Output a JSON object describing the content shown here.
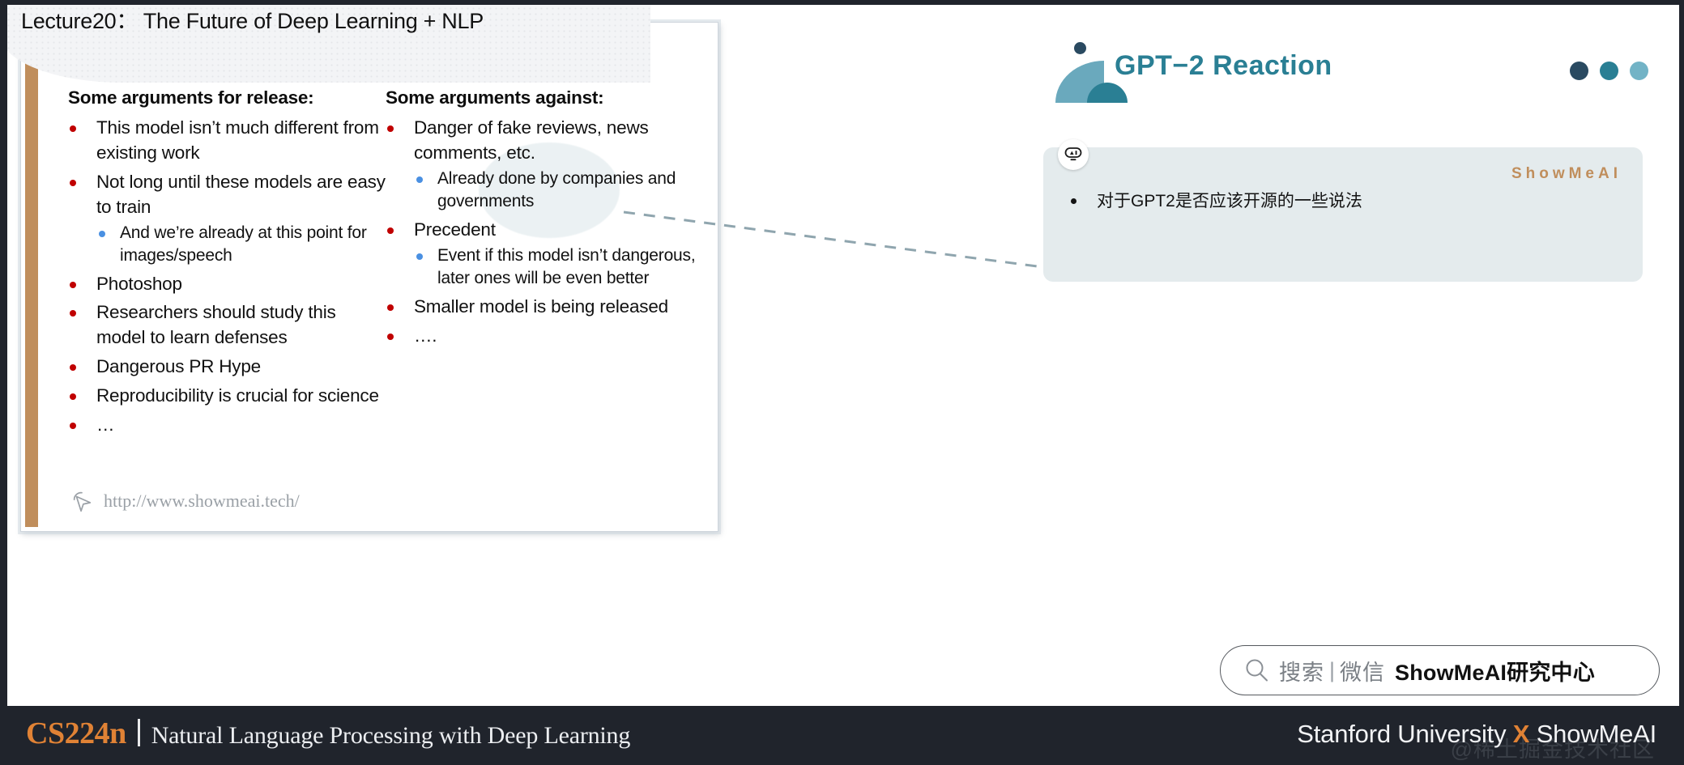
{
  "slide": {
    "title": "GPT-2 Reaction",
    "left_column": {
      "heading": "Some arguments for release:",
      "bullets": [
        {
          "text": "This model isn’t much different from existing work",
          "sub": []
        },
        {
          "text": "Not long until these models are easy to train",
          "sub": [
            "And we’re already at this point for images/speech"
          ]
        },
        {
          "text": "Photoshop",
          "sub": []
        },
        {
          "text": "Researchers should study this model to learn defenses",
          "sub": []
        },
        {
          "text": "Dangerous PR Hype",
          "sub": []
        },
        {
          "text": "Reproducibility is crucial for science",
          "sub": []
        },
        {
          "text": "…",
          "sub": []
        }
      ]
    },
    "right_column": {
      "heading": "Some arguments against:",
      "bullets": [
        {
          "text": "Danger of fake reviews, news comments, etc.",
          "sub": [
            "Already done by companies and governments"
          ]
        },
        {
          "text": "Precedent",
          "sub": [
            "Event if this model isn’t dangerous, later ones will be even better"
          ]
        },
        {
          "text": "Smaller model is being released",
          "sub": []
        },
        {
          "text": "….",
          "sub": []
        }
      ]
    },
    "url": "http://www.showmeai.tech/",
    "url_icon": "cursor-pointer-icon",
    "accent_bar_color": "#c08e5c",
    "title_color": "#2d7fe0",
    "bullet_color_level1": "#c00000",
    "bullet_color_level2": "#4a90e2"
  },
  "right_panel": {
    "lecture_banner": "Lecture20： The Future of Deep Learning + NLP",
    "panel_title": "GPT−2 Reaction",
    "panel_title_color": "#2a7f94",
    "dots": [
      "#2a4a61",
      "#2a7f94",
      "#72b3c6"
    ],
    "note_box": {
      "icon": "ai-robot-icon",
      "brand": "ShowMeAI",
      "brand_color": "#c08e5c",
      "bullets": [
        "对于GPT2是否应该开源的一些说法"
      ],
      "background": "#e4ebed"
    },
    "search_pill": {
      "icon": "search-icon",
      "label_gray": "搜索",
      "divider": "|",
      "label_gray2": "微信",
      "label_bold": "ShowMeAI研究中心"
    }
  },
  "bottom_bar": {
    "course_code": "CS224n",
    "course_name": "Natural Language Processing with Deep Learning",
    "right_text_prefix": "Stanford University ",
    "right_text_x": "X",
    "right_text_suffix": " ShowMeAI",
    "watermark": "@稀土掘金技术社区",
    "accent_color": "#e08235",
    "background": "#20242c"
  }
}
